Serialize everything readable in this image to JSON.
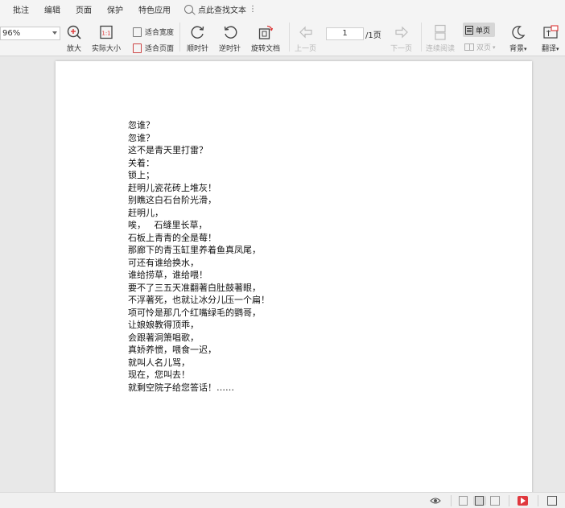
{
  "menu": {
    "items": [
      "批注",
      "编辑",
      "页面",
      "保护",
      "特色应用"
    ],
    "search_label": "点此查找文本",
    "more": "⋮"
  },
  "toolbar": {
    "zoom_value": "96%",
    "zoom_in": "放大",
    "actual_size": "实际大小",
    "fit_width": "适合宽度",
    "fit_page": "适合页面",
    "rotate_cw": "顺时针",
    "rotate_ccw": "逆时针",
    "rotate_doc": "旋转文档",
    "prev_page": "上一页",
    "current_page": "1",
    "total_pages": "/1页",
    "next_page": "下一页",
    "continuous": "连续阅读",
    "single_page": "单页",
    "double_page": "双页",
    "background": "背景",
    "translate": "翻译"
  },
  "document": {
    "lines": [
      "忽谁？",
      "忽谁？",
      "这不是青天里打雷？",
      "关着：",
      "锁上；",
      "赶明儿瓷花砖上堆灰！",
      "别瞧这白石台阶光滑，",
      "赶明儿，",
      "唉，   石缝里长草，",
      "石板上青青的全是莓！",
      "那廊下的青玉缸里养着鱼真凤尾，",
      "可还有谁给换水，",
      "谁给捞草，谁给喂！",
      "要不了三五天准翻著白肚鼓著眼，",
      "不浮著死，也就让冰分儿压一个扁！",
      "项可怜是那几个红嘴绿毛的鹦哥，",
      "让娘娘教得顶乖，",
      "会跟著洞箫唱歌，",
      "真娇养惯，喂食一迟，",
      "就叫人名儿骂，",
      "现在，您叫去！",
      "就剩空院子给您答话！……"
    ]
  }
}
